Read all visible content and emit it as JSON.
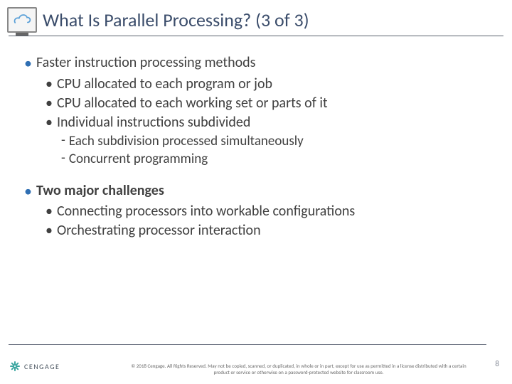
{
  "title": "What Is Parallel Processing? (3 of 3)",
  "bullets": [
    {
      "text": "Faster instruction processing methods",
      "children": [
        {
          "text": "CPU allocated to each program or job"
        },
        {
          "text": "CPU allocated to each working set or parts of it"
        },
        {
          "text": "Individual instructions subdivided",
          "children": [
            {
              "text": "Each subdivision processed simultaneously"
            },
            {
              "text": "Concurrent programming"
            }
          ]
        }
      ]
    },
    {
      "text": "Two major challenges",
      "bold": true,
      "children": [
        {
          "text": "Connecting processors into workable configurations"
        },
        {
          "text": "Orchestrating processor interaction"
        }
      ]
    }
  ],
  "footer": {
    "brand": "CENGAGE",
    "copyright": "© 2018 Cengage. All Rights Reserved. May not be copied, scanned, or duplicated, in whole or in part, except for use as permitted in a license distributed with a certain product or service or otherwise on a password-protected website for classroom use.",
    "page": "8"
  }
}
